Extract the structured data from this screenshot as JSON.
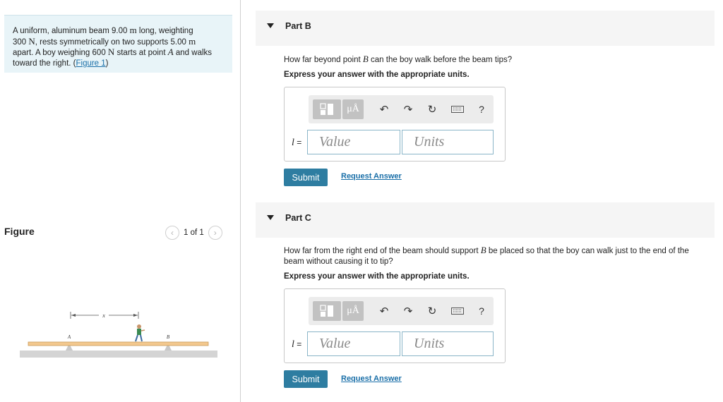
{
  "problem": {
    "text_1": "A uniform, aluminum beam 9.00 ",
    "unit_m": "m",
    "text_2": " long, weighting",
    "text_3": "300 ",
    "unit_N": "N",
    "text_4": ", rests symmetrically on two supports 5.00 ",
    "text_5": "apart. A boy weighing 600 ",
    "text_6": " starts at point ",
    "point_A": "A",
    "text_7": " and walks",
    "text_8": "toward the right. (",
    "figure_link": "Figure 1",
    "text_9": ")"
  },
  "figure": {
    "title": "Figure",
    "pager": "1 of 1",
    "label_x": "x",
    "label_A": "A",
    "label_B": "B"
  },
  "parts": [
    {
      "label": "Part B",
      "question_a": "How far beyond point ",
      "question_var": "B",
      "question_b": " can the boy walk before the beam tips?",
      "instruction": "Express your answer with the appropriate units.",
      "variable": "l",
      "equals": " =",
      "value_placeholder": "Value",
      "units_placeholder": "Units",
      "submit": "Submit",
      "request": "Request Answer"
    },
    {
      "label": "Part C",
      "question_a": "How far from the right end of the beam should support ",
      "question_var": "B",
      "question_b": " be placed so that the boy can walk just to the end of the",
      "question_c": "beam without causing it to tip?",
      "instruction": "Express your answer with the appropriate units.",
      "variable": "l",
      "equals": " =",
      "value_placeholder": "Value",
      "units_placeholder": "Units",
      "submit": "Submit",
      "request": "Request Answer"
    }
  ],
  "toolbar": {
    "mu_label": "μÅ",
    "help": "?",
    "icons": [
      "templates-icon",
      "units-icon",
      "undo-icon",
      "redo-icon",
      "reset-icon",
      "keyboard-icon",
      "help-icon"
    ]
  },
  "colors": {
    "problem_bg": "#e8f4f8",
    "link": "#1a6fa8",
    "submit_bg": "#2e7da1",
    "beam": "#f3c88e"
  }
}
